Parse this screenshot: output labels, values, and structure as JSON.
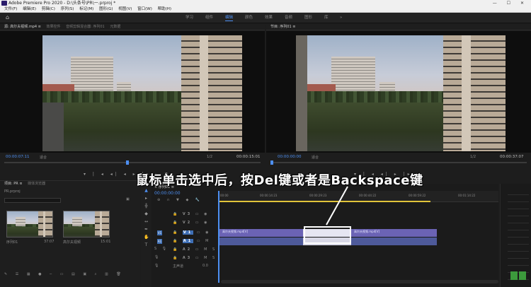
{
  "window": {
    "title": "Adobe Premiere Pro 2020 - D:\\头条号\\PR\\一.prproj *",
    "controls": "— ☐ ✕"
  },
  "menu": [
    "文件(F)",
    "编辑(E)",
    "剪辑(C)",
    "序列(S)",
    "标记(M)",
    "图形(G)",
    "视图(V)",
    "窗口(W)",
    "帮助(H)"
  ],
  "workspaces": [
    "学习",
    "组件",
    "编辑",
    "颜色",
    "效果",
    "音频",
    "图形",
    "库",
    "»"
  ],
  "source_panel": {
    "tabs": [
      "源: 高尔夫视频.mp4 ≡",
      "效果控件",
      "音频剪辑混合器: 序列01",
      "元数据"
    ],
    "timecode_left": "00:00:07:11",
    "fit": "适合",
    "fraction": "1/2",
    "timecode_right": "00:00:15:01"
  },
  "program_panel": {
    "tabs": [
      "节目: 序列01 ≡"
    ],
    "timecode_left": "00:00:00:00",
    "fit": "适合",
    "fraction": "1/2",
    "timecode_right": "00:00:37:07"
  },
  "project_panel": {
    "tabs": [
      "项目: PR ≡",
      "媒体浏览器"
    ],
    "path": "PR.prproj",
    "items": [
      {
        "name": "序列01",
        "duration": "37:07"
      },
      {
        "name": "高尔夫视频",
        "duration": "15:01"
      }
    ]
  },
  "timeline": {
    "tab": "× 序列01 ≡",
    "timecode": "00:00:00:00",
    "ruler": [
      "00:00",
      "00:00:14:23",
      "00:00:29:23",
      "00:00:44:22",
      "00:00:59:22",
      "00:01:14:22"
    ],
    "video_tracks": [
      "V3",
      "V2",
      "V1"
    ],
    "audio_tracks": [
      "A1",
      "A2",
      "A3"
    ],
    "master": "主声道",
    "master_value": "0.0",
    "clip_left": "高尔夫视频.mp4[V]",
    "clip_right": "高尔夫视频.mp4[V]"
  },
  "caption": "鼠标单击选中后，按Del键或者是Backspace键",
  "colors": {
    "accent": "#4d8ff2",
    "clip": "#6b63b5",
    "workarea": "#e1c43a"
  }
}
